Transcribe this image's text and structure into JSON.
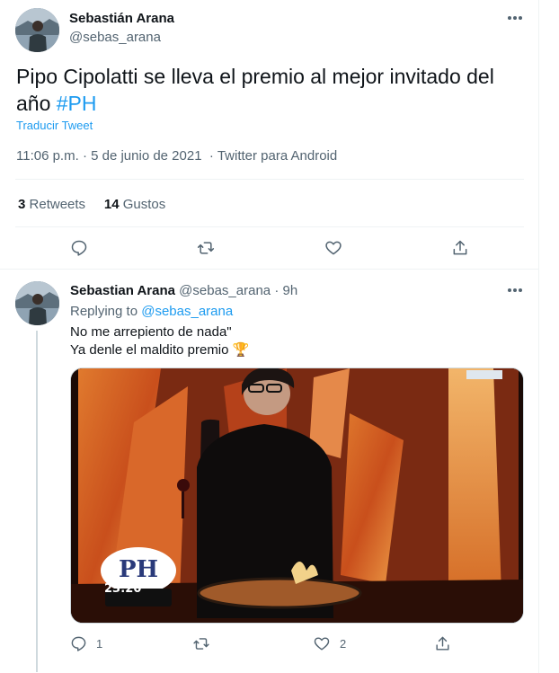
{
  "tweet": {
    "author_name": "Sebastián Arana",
    "author_handle": "@sebas_arana",
    "text": "Pipo Cipolatti se lleva el premio al mejor invitado del año ",
    "hashtag": "#PH",
    "translate_label": "Traducir Tweet",
    "time": "11:06 p.m.",
    "date": "5 de junio de 2021",
    "client": "Twitter para Android",
    "separator": "·",
    "retweets_count": "3",
    "retweets_label": "Retweets",
    "likes_count": "14",
    "likes_label": "Gustos"
  },
  "reply": {
    "author_name": "Sebastian Arana",
    "author_handle": "@sebas_arana",
    "separator": "·",
    "time_ago": "9h",
    "replying_label": "Replying to",
    "replying_handle": "@sebas_arana",
    "line1": "No me arrepiento de nada\"",
    "line2": "Ya denle el maldito premio 🏆",
    "media_overlay_time": "23:20",
    "reply_count": "1",
    "like_count": "2"
  },
  "icons": {
    "more": "more-horizontal-icon",
    "reply": "reply-icon",
    "retweet": "retweet-icon",
    "like": "heart-icon",
    "share": "share-icon"
  },
  "colors": {
    "accent": "#1d9bf0",
    "secondary_text": "#536471",
    "divider": "#eff3f4"
  }
}
